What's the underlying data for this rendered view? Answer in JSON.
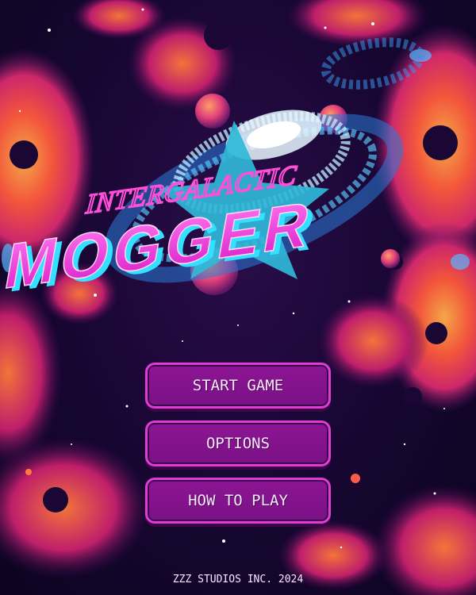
{
  "game": {
    "title_line1": "INTERGALACTIC",
    "title_line2": "MOGGER"
  },
  "menu": {
    "start_label": "START GAME",
    "options_label": "OPTIONS",
    "howto_label": "HOW TO PLAY"
  },
  "footer": {
    "credit": "ZZZ STUDIOS INC. 2024"
  },
  "colors": {
    "background": "#160630",
    "nebula_orange": "#ff6a3a",
    "nebula_pink": "#ff3d8b",
    "button_fill": "#8d1594",
    "button_border": "#e23ad6",
    "title_magenta": "#ff3ce8",
    "title_cyan": "#32e0ff",
    "star_cyan": "#30b8d8"
  },
  "icons": [
    "galaxy-swirl-icon",
    "star-icon",
    "planet-icon"
  ]
}
